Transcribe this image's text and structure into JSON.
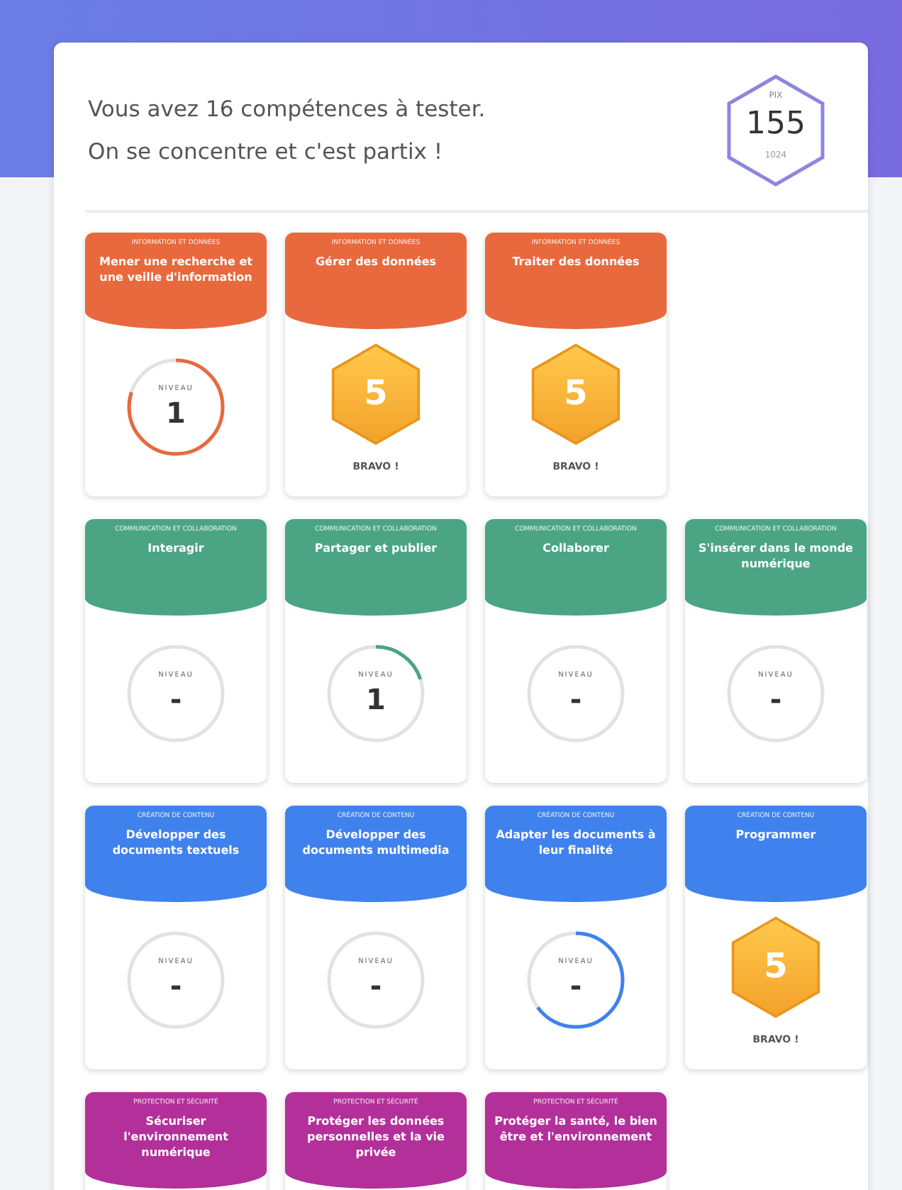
{
  "header": {
    "lines": [
      "Vous avez 16 compétences à tester.",
      "On se concentre et c'est partix !"
    ],
    "pix": {
      "label": "PIX",
      "score": "155",
      "max": "1024"
    }
  },
  "domains": [
    {
      "color": "#e8693d",
      "competences": [
        {
          "domain": "INFORMATION ET DONNÉES",
          "title": "Mener une recherche et une veille d'information",
          "kind": "ring",
          "caption": "NIVEAU",
          "value": "1",
          "level": 0.8
        },
        {
          "domain": "INFORMATION ET DONNÉES",
          "title": "Gérer des données",
          "kind": "badge",
          "value": "5",
          "caption": "BRAVO !"
        },
        {
          "domain": "INFORMATION ET DONNÉES",
          "title": "Traiter des données",
          "kind": "badge",
          "value": "5",
          "caption": "BRAVO !"
        }
      ]
    },
    {
      "color": "#4ba584",
      "competences": [
        {
          "domain": "COMMUNICATION ET COLLABORATION",
          "title": "Interagir",
          "kind": "ring",
          "caption": "NIVEAU",
          "value": "-"
        },
        {
          "domain": "COMMUNICATION ET COLLABORATION",
          "title": "Partager et publier",
          "kind": "ring",
          "caption": "NIVEAU",
          "value": "1",
          "level": 0.2
        },
        {
          "domain": "COMMUNICATION ET COLLABORATION",
          "title": "Collaborer",
          "kind": "ring",
          "caption": "NIVEAU",
          "value": "-"
        },
        {
          "domain": "COMMUNICATION ET COLLABORATION",
          "title": "S'insérer dans le monde numérique",
          "kind": "ring",
          "caption": "NIVEAU",
          "value": "-"
        }
      ]
    },
    {
      "color": "#3f82ee",
      "competences": [
        {
          "domain": "CRÉATION DE CONTENU",
          "title": "Développer des documents textuels",
          "kind": "ring",
          "caption": "NIVEAU",
          "value": "-"
        },
        {
          "domain": "CRÉATION DE CONTENU",
          "title": "Développer des documents multimedia",
          "kind": "ring",
          "caption": "NIVEAU",
          "value": "-"
        },
        {
          "domain": "CRÉATION DE CONTENU",
          "title": "Adapter les documents à leur finalité",
          "kind": "ring",
          "caption": "NIVEAU",
          "value": "-",
          "level": 0.65
        },
        {
          "domain": "CRÉATION DE CONTENU",
          "title": "Programmer",
          "kind": "badge",
          "value": "5",
          "caption": "BRAVO !"
        }
      ]
    },
    {
      "color": "#b3309a",
      "competences": [
        {
          "domain": "PROTECTION ET SÉCURITÉ",
          "title": "Sécuriser l'environnement numérique",
          "kind": "cut"
        },
        {
          "domain": "PROTECTION ET SÉCURITÉ",
          "title": "Protéger les données personnelles et la vie privée",
          "kind": "cut"
        },
        {
          "domain": "PROTECTION ET SÉCURITÉ",
          "title": "Protéger la santé, le bien être et l'environnement",
          "kind": "cut"
        }
      ]
    }
  ]
}
